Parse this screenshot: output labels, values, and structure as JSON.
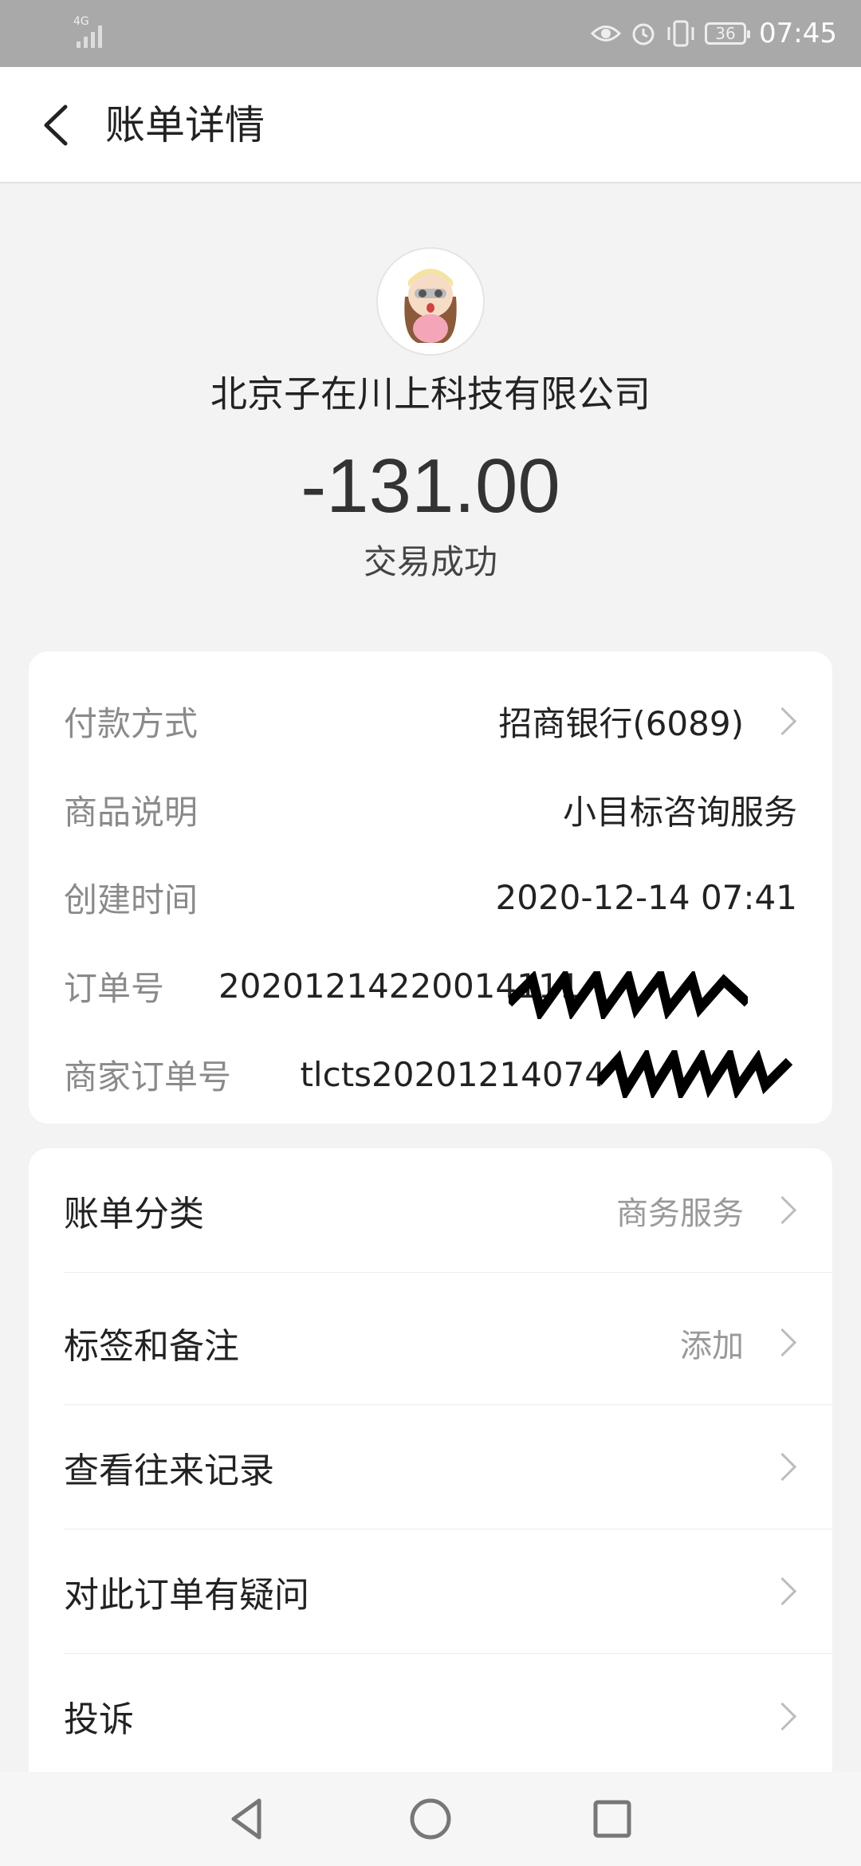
{
  "status_bar": {
    "network": "4G",
    "battery": "36",
    "time": "07:45",
    "icons": [
      "signal-icon",
      "eye-icon",
      "alarm-icon",
      "vibrate-icon",
      "battery-icon"
    ]
  },
  "header": {
    "title": "账单详情",
    "back_icon": "chevron-left-icon"
  },
  "transaction": {
    "merchant": "北京子在川上科技有限公司",
    "amount": "-131.00",
    "status": "交易成功"
  },
  "details": [
    {
      "label": "付款方式",
      "value": "招商银行(6089)"
    },
    {
      "label": "商品说明",
      "value": "小目标咨询服务"
    },
    {
      "label": "创建时间",
      "value": "2020-12-14 07:41"
    },
    {
      "label": "订单号",
      "value": "20201214220014111"
    },
    {
      "label": "商家订单号",
      "value": "tlcts20201214074"
    }
  ],
  "menu": [
    {
      "label": "账单分类",
      "value": "商务服务"
    },
    {
      "label": "标签和备注",
      "value": "添加"
    },
    {
      "label": "查看往来记录",
      "value": ""
    },
    {
      "label": "对此订单有疑问",
      "value": ""
    },
    {
      "label": "投诉",
      "value": ""
    }
  ],
  "colors": {
    "status_bar": "#a9a9a9",
    "background": "#f3f3f3",
    "card": "#ffffff",
    "label_gray": "#8a8a8a"
  }
}
